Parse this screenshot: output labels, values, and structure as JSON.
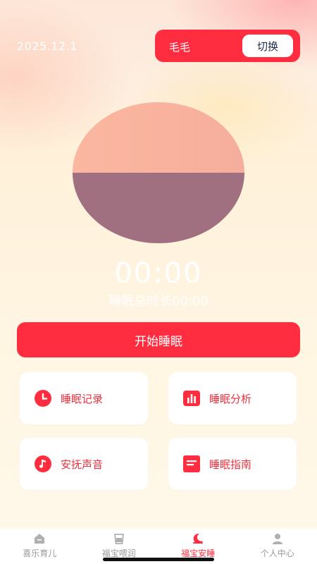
{
  "header": {
    "date": "2025.12.1",
    "baby_name": "毛毛",
    "switch_label": "切换"
  },
  "timer": {
    "elapsed": "00:00",
    "total_label": "睡眠总时长00:00"
  },
  "actions": {
    "start_label": "开始睡眠"
  },
  "cards": [
    {
      "label": "睡眠记录",
      "icon": "clock-icon"
    },
    {
      "label": "睡眠分析",
      "icon": "bar-chart-icon"
    },
    {
      "label": "安抚声音",
      "icon": "music-note-icon"
    },
    {
      "label": "睡眠指南",
      "icon": "guide-icon"
    }
  ],
  "tabs": [
    {
      "label": "喜乐育儿",
      "icon": "home-icon"
    },
    {
      "label": "福宝喂润",
      "icon": "cup-icon"
    },
    {
      "label": "福宝安睡",
      "icon": "moon-icon",
      "active": true
    },
    {
      "label": "个人中心",
      "icon": "user-icon"
    }
  ],
  "colors": {
    "accent": "#ff2d3f",
    "orb_top": "#f8b29e",
    "orb_bottom": "#a07080",
    "tab_inactive": "#9a9a9a"
  }
}
